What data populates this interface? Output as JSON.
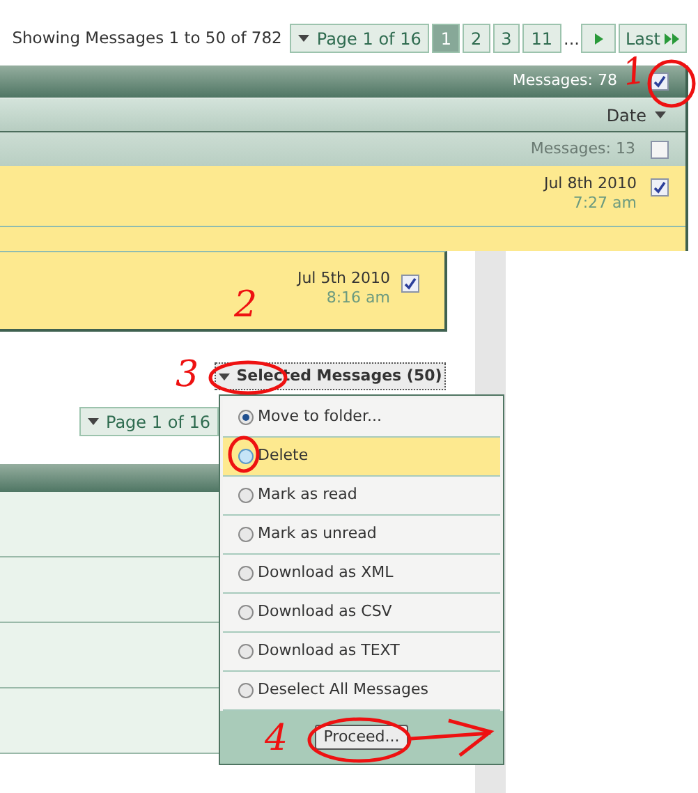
{
  "summary": "Showing Messages 1 to 50 of 782",
  "pager": {
    "menu": "Page 1 of 16",
    "pages": [
      {
        "label": "1",
        "selected": true
      },
      {
        "label": "2",
        "selected": false
      },
      {
        "label": "3",
        "selected": false
      },
      {
        "label": "11",
        "selected": false
      }
    ],
    "ellipsis": "...",
    "last": "Last"
  },
  "table": {
    "header": {
      "count": "Messages: 78",
      "checked": true
    },
    "sort": {
      "label": "Date"
    },
    "group": {
      "count": "Messages: 13",
      "checked": false
    },
    "rows": [
      {
        "date": "Jul 8th 2010",
        "time": "7:27 am",
        "checked": true
      }
    ]
  },
  "lower": {
    "row": {
      "date": "Jul 5th 2010",
      "time": "8:16 am",
      "checked": true
    },
    "action_button": "Selected Messages (50)",
    "pager": {
      "menu": "Page 1 of 16"
    },
    "menu": {
      "options": [
        {
          "label": "Move to folder...",
          "selected": true,
          "hovered": false
        },
        {
          "label": "Delete",
          "selected": false,
          "hovered": true
        },
        {
          "label": "Mark as read",
          "selected": false,
          "hovered": false
        },
        {
          "label": "Mark as unread",
          "selected": false,
          "hovered": false
        },
        {
          "label": "Download as XML",
          "selected": false,
          "hovered": false
        },
        {
          "label": "Download as CSV",
          "selected": false,
          "hovered": false
        },
        {
          "label": "Download as TEXT",
          "selected": false,
          "hovered": false
        },
        {
          "label": "Deselect All Messages",
          "selected": false,
          "hovered": false
        }
      ],
      "button": "Proceed..."
    }
  },
  "annotations": [
    {
      "label": "1"
    },
    {
      "label": "2"
    },
    {
      "label": "3"
    },
    {
      "label": "4"
    }
  ]
}
